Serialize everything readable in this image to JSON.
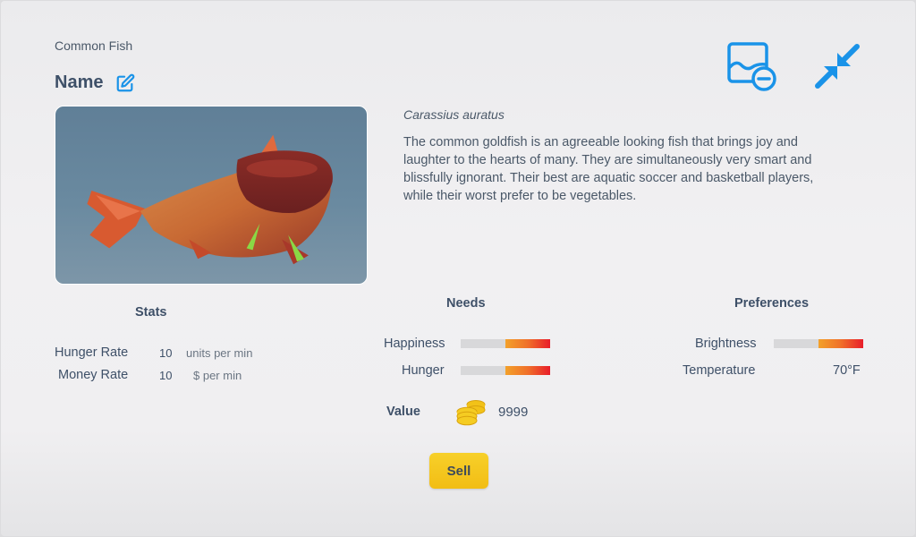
{
  "fish": {
    "category": "Common Fish",
    "name": "Name",
    "scientific_name": "Carassius auratus",
    "description": "The common goldfish is an agreeable looking fish that brings joy and laughter to the hearts of many. They are simultaneously very smart and blissfully ignorant. Their best are aquatic soccer and basketball players, while their worst prefer to be vegetables."
  },
  "toolbar": {
    "release_icon": "image-minus-icon",
    "collapse_icon": "collapse-arrows-icon",
    "accent": "#1a93e8"
  },
  "stats": {
    "title": "Stats",
    "rows": [
      {
        "label": "Hunger Rate",
        "value": "10",
        "unit": "units per min"
      },
      {
        "label": "Money Rate",
        "value": "10",
        "unit": "$ per min"
      }
    ]
  },
  "needs": {
    "title": "Needs",
    "rows": [
      {
        "label": "Happiness",
        "level": 0.5
      },
      {
        "label": "Hunger",
        "level": 0.5
      }
    ]
  },
  "preferences": {
    "title": "Preferences",
    "brightness": {
      "label": "Brightness",
      "level": 0.5
    },
    "temperature": {
      "label": "Temperature",
      "value": "70°F"
    }
  },
  "value": {
    "label": "Value",
    "amount": "9999",
    "icon": "coins-icon"
  },
  "actions": {
    "sell_label": "Sell",
    "sell_color": "#f4c51e"
  }
}
